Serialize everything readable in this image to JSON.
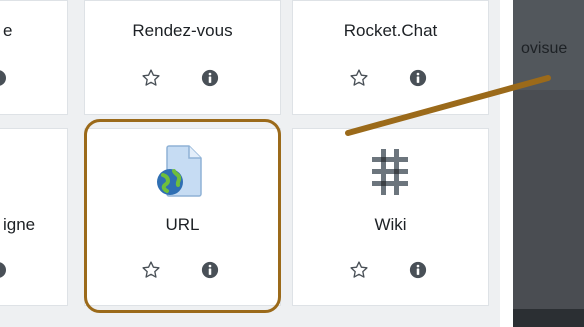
{
  "tiles": {
    "top_left": {
      "name": "e"
    },
    "top_middle": {
      "name": "Rendez-vous"
    },
    "top_right": {
      "name": "Rocket.Chat"
    },
    "bottom_left": {
      "name": "igne"
    },
    "bottom_middle": {
      "name": "URL"
    },
    "bottom_right": {
      "name": "Wiki"
    }
  },
  "icons": {
    "star": "star-outline-icon",
    "info": "info-circle-icon",
    "url": "url-globe-document-icon",
    "wiki": "wiki-puzzle-icon"
  },
  "modal": {
    "text": "ovisue"
  },
  "colors": {
    "callout": "#9b6a1a",
    "tile_border": "#dee2e6",
    "background": "#eef0f2",
    "modal": "#4a4d52"
  }
}
